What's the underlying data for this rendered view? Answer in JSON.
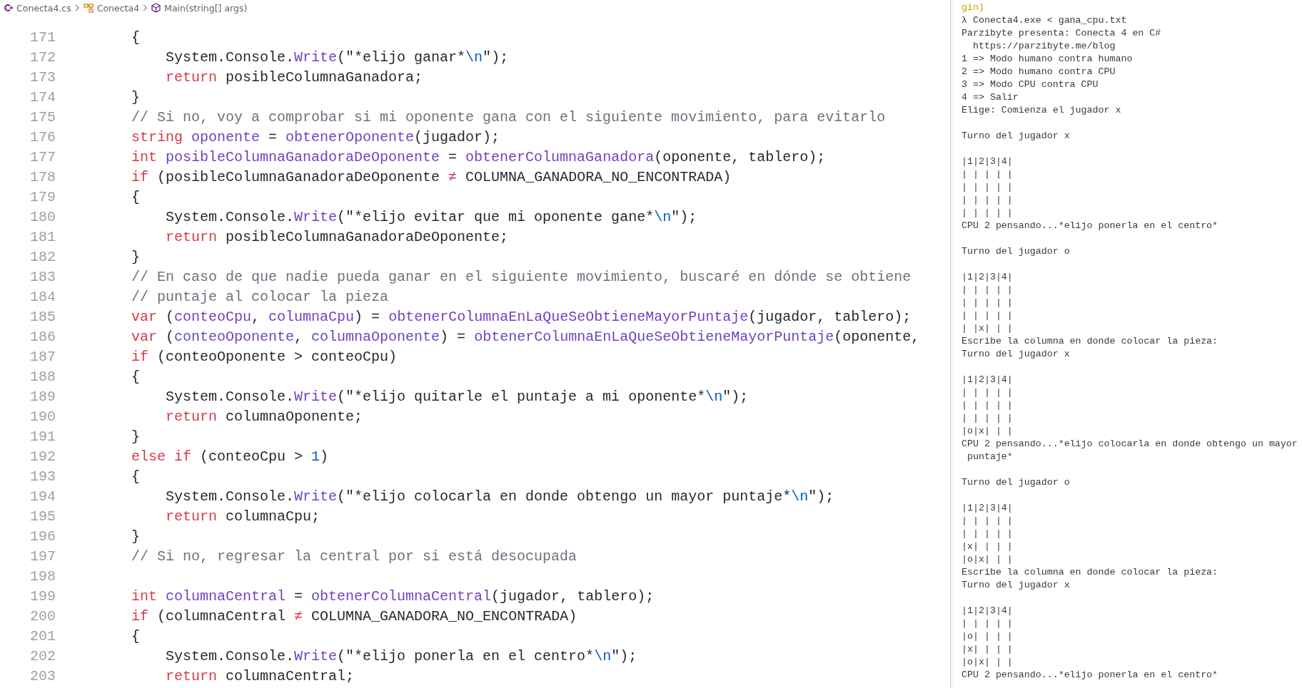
{
  "breadcrumb": [
    {
      "kind": "file",
      "label": "Conecta4.cs"
    },
    {
      "kind": "class",
      "label": "Conecta4"
    },
    {
      "kind": "method",
      "label": "Main(string[] args)"
    }
  ],
  "editor": {
    "lines": [
      {
        "number": "171",
        "kind": "outer",
        "tokens": [
          {
            "kind": "plain",
            "text": "{"
          }
        ]
      },
      {
        "number": "172",
        "kind": "inner",
        "tokens": [
          {
            "kind": "plain",
            "text": "System.Console."
          },
          {
            "kind": "function",
            "text": "Write"
          },
          {
            "kind": "plain",
            "text": "("
          },
          {
            "kind": "string",
            "text": "\"*elijo ganar*"
          },
          {
            "kind": "escape",
            "text": "\\n"
          },
          {
            "kind": "string",
            "text": "\""
          },
          {
            "kind": "plain",
            "text": ");"
          }
        ]
      },
      {
        "number": "173",
        "kind": "inner",
        "tokens": [
          {
            "kind": "keyword",
            "text": "return"
          },
          {
            "kind": "plain",
            "text": " posibleColumnaGanadora;"
          }
        ]
      },
      {
        "number": "174",
        "kind": "outer",
        "tokens": [
          {
            "kind": "plain",
            "text": "}"
          }
        ]
      },
      {
        "number": "175",
        "kind": "outer",
        "tokens": [
          {
            "kind": "comment",
            "text": "// Si no, voy a comprobar si mi oponente gana con el siguiente movimiento, para evitarlo"
          }
        ]
      },
      {
        "number": "176",
        "kind": "outer",
        "tokens": [
          {
            "kind": "keyword",
            "text": "string "
          },
          {
            "kind": "variable",
            "text": "oponente"
          },
          {
            "kind": "plain",
            "text": " = "
          },
          {
            "kind": "function",
            "text": "obtenerOponente"
          },
          {
            "kind": "plain",
            "text": "(jugador);"
          }
        ]
      },
      {
        "number": "177",
        "kind": "outer",
        "tokens": [
          {
            "kind": "keyword",
            "text": "int "
          },
          {
            "kind": "variable",
            "text": "posibleColumnaGanadoraDeOponente"
          },
          {
            "kind": "plain",
            "text": " = "
          },
          {
            "kind": "function",
            "text": "obtenerColumnaGanadora"
          },
          {
            "kind": "plain",
            "text": "(oponente, tablero);"
          }
        ]
      },
      {
        "number": "178",
        "kind": "outer",
        "tokens": [
          {
            "kind": "keyword",
            "text": "if"
          },
          {
            "kind": "plain",
            "text": " (posibleColumnaGanadoraDeOponente "
          },
          {
            "kind": "keyword",
            "text": "≠"
          },
          {
            "kind": "plain",
            "text": " COLUMNA_GANADORA_NO_ENCONTRADA)"
          }
        ]
      },
      {
        "number": "179",
        "kind": "outer",
        "tokens": [
          {
            "kind": "plain",
            "text": "{"
          }
        ]
      },
      {
        "number": "180",
        "kind": "inner",
        "tokens": [
          {
            "kind": "plain",
            "text": "System.Console."
          },
          {
            "kind": "function",
            "text": "Write"
          },
          {
            "kind": "plain",
            "text": "("
          },
          {
            "kind": "string",
            "text": "\"*elijo evitar que mi oponente gane*"
          },
          {
            "kind": "escape",
            "text": "\\n"
          },
          {
            "kind": "string",
            "text": "\""
          },
          {
            "kind": "plain",
            "text": ");"
          }
        ]
      },
      {
        "number": "181",
        "kind": "inner",
        "tokens": [
          {
            "kind": "keyword",
            "text": "return"
          },
          {
            "kind": "plain",
            "text": " posibleColumnaGanadoraDeOponente;"
          }
        ]
      },
      {
        "number": "182",
        "kind": "outer",
        "tokens": [
          {
            "kind": "plain",
            "text": "}"
          }
        ]
      },
      {
        "number": "183",
        "kind": "outer",
        "tokens": [
          {
            "kind": "comment",
            "text": "// En caso de que nadie pueda ganar en el siguiente movimiento, buscaré en dónde se obtiene"
          }
        ]
      },
      {
        "number": "184",
        "kind": "outer",
        "tokens": [
          {
            "kind": "comment",
            "text": "// puntaje al colocar la pieza"
          }
        ]
      },
      {
        "number": "185",
        "kind": "outer",
        "tokens": [
          {
            "kind": "keyword",
            "text": "var"
          },
          {
            "kind": "plain",
            "text": " ("
          },
          {
            "kind": "variable",
            "text": "conteoCpu"
          },
          {
            "kind": "plain",
            "text": ", "
          },
          {
            "kind": "variable",
            "text": "columnaCpu"
          },
          {
            "kind": "plain",
            "text": ") = "
          },
          {
            "kind": "function",
            "text": "obtenerColumnaEnLaQueSeObtieneMayorPuntaje"
          },
          {
            "kind": "plain",
            "text": "(jugador, tablero);"
          }
        ]
      },
      {
        "number": "186",
        "kind": "outer",
        "tokens": [
          {
            "kind": "keyword",
            "text": "var"
          },
          {
            "kind": "plain",
            "text": " ("
          },
          {
            "kind": "variable",
            "text": "conteoOponente"
          },
          {
            "kind": "plain",
            "text": ", "
          },
          {
            "kind": "variable",
            "text": "columnaOponente"
          },
          {
            "kind": "plain",
            "text": ") = "
          },
          {
            "kind": "function",
            "text": "obtenerColumnaEnLaQueSeObtieneMayorPuntaje"
          },
          {
            "kind": "plain",
            "text": "(oponente,"
          }
        ]
      },
      {
        "number": "187",
        "kind": "outer",
        "tokens": [
          {
            "kind": "keyword",
            "text": "if"
          },
          {
            "kind": "plain",
            "text": " (conteoOponente > conteoCpu)"
          }
        ]
      },
      {
        "number": "188",
        "kind": "outer",
        "tokens": [
          {
            "kind": "plain",
            "text": "{"
          }
        ]
      },
      {
        "number": "189",
        "kind": "inner",
        "tokens": [
          {
            "kind": "plain",
            "text": "System.Console."
          },
          {
            "kind": "function",
            "text": "Write"
          },
          {
            "kind": "plain",
            "text": "("
          },
          {
            "kind": "string",
            "text": "\"*elijo quitarle el puntaje a mi oponente*"
          },
          {
            "kind": "escape",
            "text": "\\n"
          },
          {
            "kind": "string",
            "text": "\""
          },
          {
            "kind": "plain",
            "text": ");"
          }
        ]
      },
      {
        "number": "190",
        "kind": "inner",
        "tokens": [
          {
            "kind": "keyword",
            "text": "return"
          },
          {
            "kind": "plain",
            "text": " columnaOponente;"
          }
        ]
      },
      {
        "number": "191",
        "kind": "outer",
        "tokens": [
          {
            "kind": "plain",
            "text": "}"
          }
        ]
      },
      {
        "number": "192",
        "kind": "outer",
        "tokens": [
          {
            "kind": "keyword",
            "text": "else if"
          },
          {
            "kind": "plain",
            "text": " (conteoCpu > "
          },
          {
            "kind": "number",
            "text": "1"
          },
          {
            "kind": "plain",
            "text": ")"
          }
        ]
      },
      {
        "number": "193",
        "kind": "outer",
        "tokens": [
          {
            "kind": "plain",
            "text": "{"
          }
        ]
      },
      {
        "number": "194",
        "kind": "inner",
        "tokens": [
          {
            "kind": "plain",
            "text": "System.Console."
          },
          {
            "kind": "function",
            "text": "Write"
          },
          {
            "kind": "plain",
            "text": "("
          },
          {
            "kind": "string",
            "text": "\"*elijo colocarla en donde obtengo un mayor puntaje*"
          },
          {
            "kind": "escape",
            "text": "\\n"
          },
          {
            "kind": "string",
            "text": "\""
          },
          {
            "kind": "plain",
            "text": ");"
          }
        ]
      },
      {
        "number": "195",
        "kind": "inner",
        "tokens": [
          {
            "kind": "keyword",
            "text": "return"
          },
          {
            "kind": "plain",
            "text": " columnaCpu;"
          }
        ]
      },
      {
        "number": "196",
        "kind": "outer",
        "tokens": [
          {
            "kind": "plain",
            "text": "}"
          }
        ]
      },
      {
        "number": "197",
        "kind": "outer",
        "tokens": [
          {
            "kind": "comment",
            "text": "// Si no, regresar la central por si está desocupada"
          }
        ]
      },
      {
        "number": "198",
        "kind": "empty"
      },
      {
        "number": "199",
        "kind": "outer",
        "tokens": [
          {
            "kind": "keyword",
            "text": "int "
          },
          {
            "kind": "variable",
            "text": "columnaCentral"
          },
          {
            "kind": "plain",
            "text": " = "
          },
          {
            "kind": "function",
            "text": "obtenerColumnaCentral"
          },
          {
            "kind": "plain",
            "text": "(jugador, tablero);"
          }
        ]
      },
      {
        "number": "200",
        "kind": "outer",
        "tokens": [
          {
            "kind": "keyword",
            "text": "if"
          },
          {
            "kind": "plain",
            "text": " (columnaCentral "
          },
          {
            "kind": "keyword",
            "text": "≠"
          },
          {
            "kind": "plain",
            "text": " COLUMNA_GANADORA_NO_ENCONTRADA)"
          }
        ]
      },
      {
        "number": "201",
        "kind": "outer",
        "tokens": [
          {
            "kind": "plain",
            "text": "{"
          }
        ]
      },
      {
        "number": "202",
        "kind": "inner",
        "tokens": [
          {
            "kind": "plain",
            "text": "System.Console."
          },
          {
            "kind": "function",
            "text": "Write"
          },
          {
            "kind": "plain",
            "text": "("
          },
          {
            "kind": "string",
            "text": "\"*elijo ponerla en el centro*"
          },
          {
            "kind": "escape",
            "text": "\\n"
          },
          {
            "kind": "string",
            "text": "\""
          },
          {
            "kind": "plain",
            "text": ");"
          }
        ]
      },
      {
        "number": "203",
        "kind": "inner",
        "tokens": [
          {
            "kind": "keyword",
            "text": "return"
          },
          {
            "kind": "plain",
            "text": " columnaCentral;"
          }
        ]
      }
    ]
  },
  "console": {
    "lines": [
      {
        "kind": "path",
        "text": "gin)"
      },
      {
        "kind": "text",
        "text": "λ Conecta4.exe < gana_cpu.txt"
      },
      {
        "kind": "text",
        "text": "Parzibyte presenta: Conecta 4 en C#"
      },
      {
        "kind": "text",
        "text": "  https://parzibyte.me/blog"
      },
      {
        "kind": "text",
        "text": "1 => Modo humano contra humano"
      },
      {
        "kind": "text",
        "text": "2 => Modo humano contra CPU"
      },
      {
        "kind": "text",
        "text": "3 => Modo CPU contra CPU"
      },
      {
        "kind": "text",
        "text": "4 => Salir"
      },
      {
        "kind": "text",
        "text": "Elige: Comienza el jugador x"
      },
      {
        "kind": "blank"
      },
      {
        "kind": "text",
        "text": "Turno del jugador x"
      },
      {
        "kind": "blank"
      },
      {
        "kind": "text",
        "text": "|1|2|3|4|"
      },
      {
        "kind": "text",
        "text": "| | | | |"
      },
      {
        "kind": "text",
        "text": "| | | | |"
      },
      {
        "kind": "text",
        "text": "| | | | |"
      },
      {
        "kind": "text",
        "text": "| | | | |"
      },
      {
        "kind": "text",
        "text": "CPU 2 pensando...*elijo ponerla en el centro*"
      },
      {
        "kind": "blank"
      },
      {
        "kind": "text",
        "text": "Turno del jugador o"
      },
      {
        "kind": "blank"
      },
      {
        "kind": "text",
        "text": "|1|2|3|4|"
      },
      {
        "kind": "text",
        "text": "| | | | |"
      },
      {
        "kind": "text",
        "text": "| | | | |"
      },
      {
        "kind": "text",
        "text": "| | | | |"
      },
      {
        "kind": "text",
        "text": "| |x| | |"
      },
      {
        "kind": "text",
        "text": "Escribe la columna en donde colocar la pieza:"
      },
      {
        "kind": "text",
        "text": "Turno del jugador x"
      },
      {
        "kind": "blank"
      },
      {
        "kind": "text",
        "text": "|1|2|3|4|"
      },
      {
        "kind": "text",
        "text": "| | | | |"
      },
      {
        "kind": "text",
        "text": "| | | | |"
      },
      {
        "kind": "text",
        "text": "| | | | |"
      },
      {
        "kind": "text",
        "text": "|o|x| | |"
      },
      {
        "kind": "text",
        "text": "CPU 2 pensando...*elijo colocarla en donde obtengo un mayor"
      },
      {
        "kind": "text",
        "text": " puntaje*"
      },
      {
        "kind": "blank"
      },
      {
        "kind": "text",
        "text": "Turno del jugador o"
      },
      {
        "kind": "blank"
      },
      {
        "kind": "text",
        "text": "|1|2|3|4|"
      },
      {
        "kind": "text",
        "text": "| | | | |"
      },
      {
        "kind": "text",
        "text": "| | | | |"
      },
      {
        "kind": "text",
        "text": "|x| | | |"
      },
      {
        "kind": "text",
        "text": "|o|x| | |"
      },
      {
        "kind": "text",
        "text": "Escribe la columna en donde colocar la pieza:"
      },
      {
        "kind": "text",
        "text": "Turno del jugador x"
      },
      {
        "kind": "blank"
      },
      {
        "kind": "text",
        "text": "|1|2|3|4|"
      },
      {
        "kind": "text",
        "text": "| | | | |"
      },
      {
        "kind": "text",
        "text": "|o| | | |"
      },
      {
        "kind": "text",
        "text": "|x| | | |"
      },
      {
        "kind": "text",
        "text": "|o|x| | |"
      },
      {
        "kind": "text",
        "text": "CPU 2 pensando...*elijo ponerla en el centro*"
      }
    ]
  }
}
